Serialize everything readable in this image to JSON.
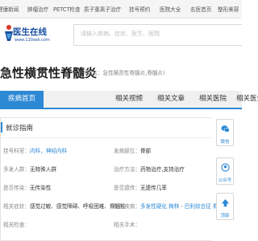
{
  "topnav": [
    "健康新闻",
    "肿瘤治疗",
    "PETCT检查",
    "质子重离子治疗",
    "挂号预约",
    "医院大全",
    "名医首页",
    "整形美容"
  ],
  "logo": {
    "name": "医生在线",
    "url": "www.120ask.com"
  },
  "search": {
    "placeholder": "请输入疾病、症状、医生、医院"
  },
  "disease": {
    "title": "急性横贯性脊髓炎",
    "alias": "(别名：急性横贯性脊髓炎,脊髓炎)"
  },
  "tabs": [
    "疾病首页",
    "相关视频",
    "相关文章",
    "相关医院",
    "相关医生"
  ],
  "guide": {
    "heading": "就诊指南",
    "rows": [
      {
        "label": "挂号科室：",
        "value": "内科，神经内科"
      },
      {
        "label": "发病部位：",
        "value": "脊部"
      },
      {
        "label": "多发人群：",
        "value": "无特殊人群"
      },
      {
        "label": "治疗方法：",
        "value": "药物治疗,支持治疗"
      },
      {
        "label": "是否传染：",
        "value": "无传染性"
      },
      {
        "label": "是否遗传：",
        "value": "无遗传几率"
      },
      {
        "label": "相关症状：",
        "value": "感觉过敏、感觉障碍、呼吸困难、脊髓性"
      },
      {
        "label": "相关疾病：",
        "value": "多发性硬化 梅林 - 巴利综合征 脊髓肿瘤"
      },
      {
        "label": "相关检查：",
        "value": ""
      },
      {
        "label": "相关手术：",
        "value": ""
      }
    ]
  },
  "side": {
    "wechat": "微信",
    "official": "公众号",
    "top": "顶部"
  },
  "colors": {
    "accent": "#2d89d4",
    "brand": "#1a4fa0"
  }
}
